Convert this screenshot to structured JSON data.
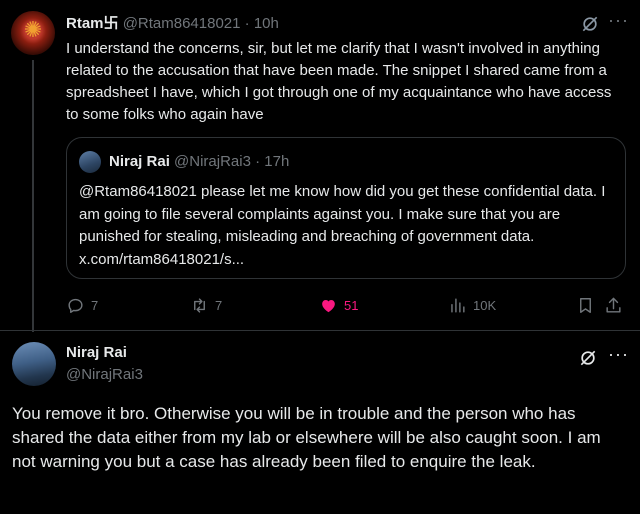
{
  "tweet": {
    "author_name": "Rtam卐",
    "handle": "@Rtam86418021",
    "separator": "·",
    "time": "10h",
    "text": "I understand the concerns, sir, but let me clarify that I wasn't involved in anything related to the accusation that have been made. The snippet I shared came from a spreadsheet I have, which I got through one of my acquaintance who have access to some folks who again have",
    "quote": {
      "author_name": "Niraj Rai",
      "handle": "@NirajRai3",
      "separator": "·",
      "time": "17h",
      "text": "@Rtam86418021 please let me know how did you get these confidential data. I am going to file several complaints against you. I make sure that you are punished for stealing, misleading and breaching of government data. x.com/rtam86418021/s..."
    },
    "actions": {
      "replies": "7",
      "reposts": "7",
      "likes": "51",
      "views": "10K"
    }
  },
  "reply": {
    "author_name": "Niraj Rai",
    "handle": "@NirajRai3",
    "text": "You remove it bro. Otherwise you will be in trouble and the person who has shared the data either from my lab or elsewhere will be also caught soon. I am not warning you but a case has already been filed to enquire the leak."
  },
  "colors": {
    "background": "#000000",
    "text": "#e7e9ea",
    "muted": "#71767b",
    "like": "#f91880",
    "border": "#2f3336"
  },
  "icons": [
    "grok-icon",
    "more-icon",
    "reply-icon",
    "repost-icon",
    "heart-icon",
    "views-icon",
    "bookmark-icon",
    "share-icon"
  ]
}
